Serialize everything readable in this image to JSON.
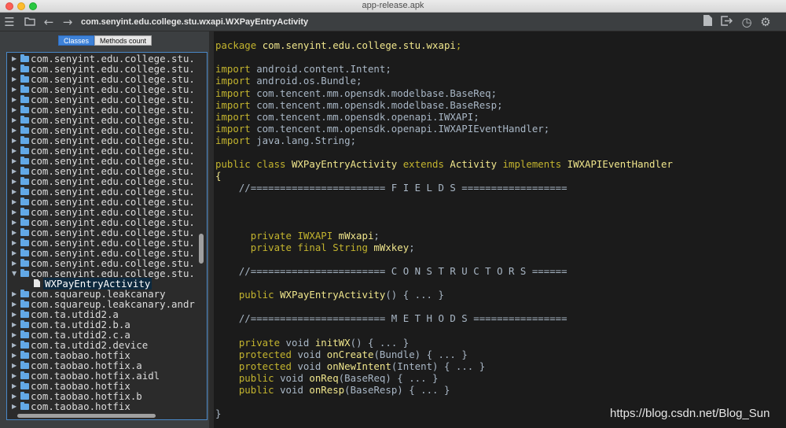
{
  "window": {
    "title": "app-release.apk"
  },
  "toolbar": {
    "path": "com.senyint.edu.college.stu.wxapi.WXPayEntryActivity",
    "icons": [
      "menu-icon",
      "open-folder-icon",
      "back-arrow-icon",
      "forward-arrow-icon",
      "file-icon",
      "export-icon",
      "history-icon",
      "settings-gear-icon"
    ]
  },
  "tabs": {
    "classes": "Classes",
    "methods_count": "Methods count"
  },
  "tree": {
    "items": [
      {
        "label": "com.senyint.edu.college.stu.",
        "expanded": false
      },
      {
        "label": "com.senyint.edu.college.stu.",
        "expanded": false
      },
      {
        "label": "com.senyint.edu.college.stu.",
        "expanded": false
      },
      {
        "label": "com.senyint.edu.college.stu.",
        "expanded": false
      },
      {
        "label": "com.senyint.edu.college.stu.",
        "expanded": false
      },
      {
        "label": "com.senyint.edu.college.stu.",
        "expanded": false
      },
      {
        "label": "com.senyint.edu.college.stu.",
        "expanded": false
      },
      {
        "label": "com.senyint.edu.college.stu.",
        "expanded": false
      },
      {
        "label": "com.senyint.edu.college.stu.",
        "expanded": false
      },
      {
        "label": "com.senyint.edu.college.stu.",
        "expanded": false
      },
      {
        "label": "com.senyint.edu.college.stu.",
        "expanded": false
      },
      {
        "label": "com.senyint.edu.college.stu.",
        "expanded": false
      },
      {
        "label": "com.senyint.edu.college.stu.",
        "expanded": false
      },
      {
        "label": "com.senyint.edu.college.stu.",
        "expanded": false
      },
      {
        "label": "com.senyint.edu.college.stu.",
        "expanded": false
      },
      {
        "label": "com.senyint.edu.college.stu.",
        "expanded": false
      },
      {
        "label": "com.senyint.edu.college.stu.",
        "expanded": false
      },
      {
        "label": "com.senyint.edu.college.stu.",
        "expanded": false
      },
      {
        "label": "com.senyint.edu.college.stu.",
        "expanded": false
      },
      {
        "label": "com.senyint.edu.college.stu.",
        "expanded": false
      },
      {
        "label": "com.senyint.edu.college.stu.",
        "expanded": false
      },
      {
        "label": "com.senyint.edu.college.stu.",
        "expanded": true
      },
      {
        "label": "WXPayEntryActivity",
        "type": "file",
        "selected": true
      },
      {
        "label": "com.squareup.leakcanary",
        "expanded": false
      },
      {
        "label": "com.squareup.leakcanary.andr",
        "expanded": false
      },
      {
        "label": "com.ta.utdid2.a",
        "expanded": false
      },
      {
        "label": "com.ta.utdid2.b.a",
        "expanded": false
      },
      {
        "label": "com.ta.utdid2.c.a",
        "expanded": false
      },
      {
        "label": "com.ta.utdid2.device",
        "expanded": false
      },
      {
        "label": "com.taobao.hotfix",
        "expanded": false
      },
      {
        "label": "com.taobao.hotfix.a",
        "expanded": false
      },
      {
        "label": "com.taobao.hotfix.aidl",
        "expanded": false
      },
      {
        "label": "com.taobao.hotfix",
        "expanded": false
      },
      {
        "label": "com.taobao.hotfix.b",
        "expanded": false
      },
      {
        "label": "com.taobao.hotfix",
        "expanded": false
      }
    ]
  },
  "code": {
    "lines": [
      [],
      [
        [
          "kw",
          "package "
        ],
        [
          "cls",
          "com.senyint.edu.college.stu.wxapi"
        ],
        [
          "kw",
          ";"
        ]
      ],
      [],
      [
        [
          "kw",
          "import "
        ],
        [
          "id",
          "android.content.Intent;"
        ]
      ],
      [
        [
          "kw",
          "import "
        ],
        [
          "id",
          "android.os.Bundle;"
        ]
      ],
      [
        [
          "kw",
          "import "
        ],
        [
          "id",
          "com.tencent.mm.opensdk.modelbase.BaseReq;"
        ]
      ],
      [
        [
          "kw",
          "import "
        ],
        [
          "id",
          "com.tencent.mm.opensdk.modelbase.BaseResp;"
        ]
      ],
      [
        [
          "kw",
          "import "
        ],
        [
          "id",
          "com.tencent.mm.opensdk.openapi.IWXAPI;"
        ]
      ],
      [
        [
          "kw",
          "import "
        ],
        [
          "id",
          "com.tencent.mm.opensdk.openapi.IWXAPIEventHandler;"
        ]
      ],
      [
        [
          "kw",
          "import "
        ],
        [
          "id",
          "java.lang.String;"
        ]
      ],
      [],
      [
        [
          "kw",
          "public class "
        ],
        [
          "cls",
          "WXPayEntryActivity"
        ],
        [
          "kw",
          " extends "
        ],
        [
          "cls",
          "Activity"
        ],
        [
          "kw",
          " implements "
        ],
        [
          "cls",
          "IWXAPIEventHandler"
        ]
      ],
      [
        [
          "fn",
          "{"
        ]
      ],
      [
        [
          "cm",
          "    //======================= F I E L D S =================="
        ]
      ],
      [],
      [],
      [],
      [
        [
          "kw",
          "      private "
        ],
        [
          "kw",
          "IWXAPI "
        ],
        [
          "fn",
          "mWxapi"
        ],
        [
          "id",
          ";"
        ]
      ],
      [
        [
          "kw",
          "      private final "
        ],
        [
          "kw",
          "String "
        ],
        [
          "fn",
          "mWxkey"
        ],
        [
          "id",
          ";"
        ]
      ],
      [],
      [
        [
          "cm",
          "    //======================= C O N S T R U C T O R S ======"
        ]
      ],
      [],
      [
        [
          "kw",
          "    public "
        ],
        [
          "fn",
          "WXPayEntryActivity"
        ],
        [
          "id",
          "() { ... }"
        ]
      ],
      [],
      [
        [
          "cm",
          "    //======================= M E T H O D S ================"
        ]
      ],
      [],
      [
        [
          "kw",
          "    private "
        ],
        [
          "id",
          "void "
        ],
        [
          "fn",
          "initWX"
        ],
        [
          "id",
          "() { ... }"
        ]
      ],
      [
        [
          "kw",
          "    protected "
        ],
        [
          "id",
          "void "
        ],
        [
          "fn",
          "onCreate"
        ],
        [
          "id",
          "(Bundle) { ... }"
        ]
      ],
      [
        [
          "kw",
          "    protected "
        ],
        [
          "id",
          "void "
        ],
        [
          "fn",
          "onNewIntent"
        ],
        [
          "id",
          "(Intent) { ... }"
        ]
      ],
      [
        [
          "kw",
          "    public "
        ],
        [
          "id",
          "void "
        ],
        [
          "fn",
          "onReq"
        ],
        [
          "id",
          "(BaseReq) { ... }"
        ]
      ],
      [
        [
          "kw",
          "    public "
        ],
        [
          "id",
          "void "
        ],
        [
          "fn",
          "onResp"
        ],
        [
          "id",
          "(BaseResp) { ... }"
        ]
      ],
      [],
      [
        [
          "id",
          "}"
        ]
      ]
    ]
  },
  "watermark": "https://blog.csdn.net/Blog_Sun"
}
